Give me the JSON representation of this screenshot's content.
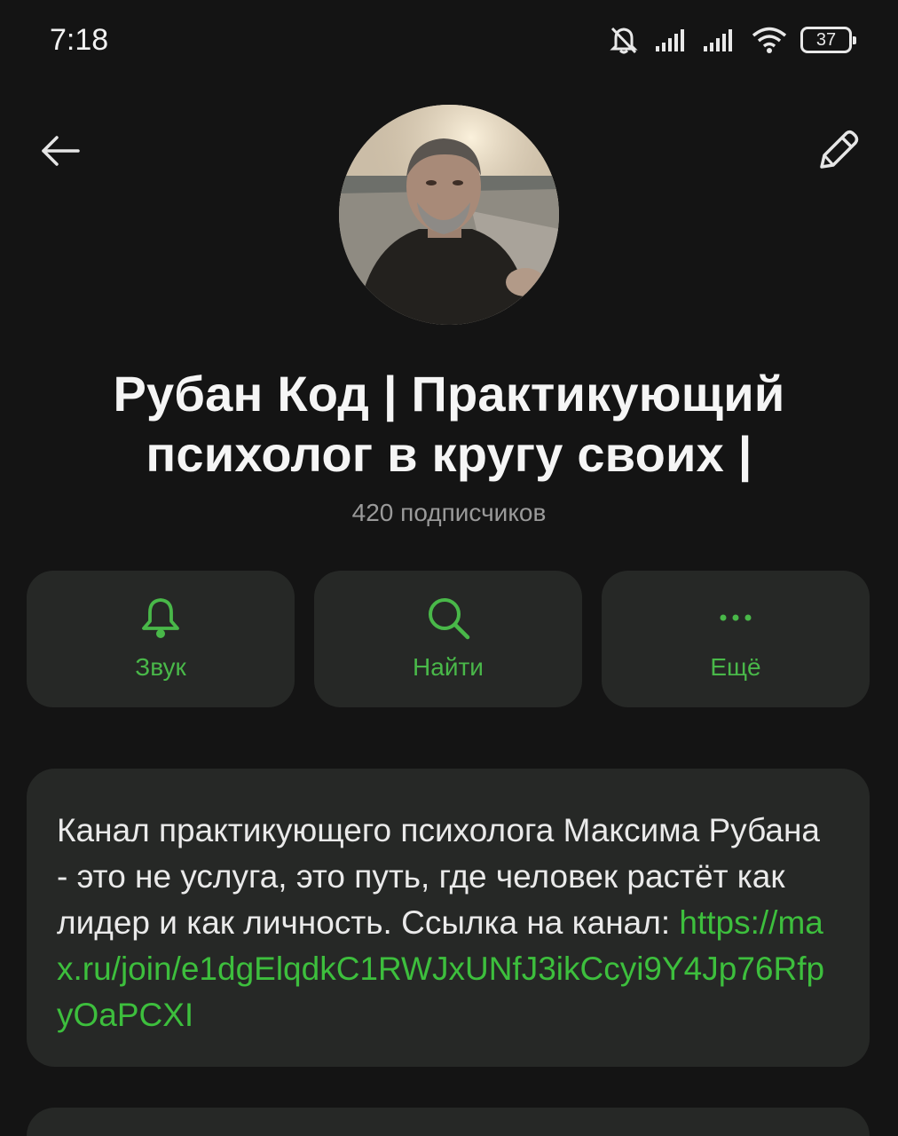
{
  "status_bar": {
    "time": "7:18",
    "battery": "37",
    "icons": [
      "mute-icon",
      "signal-icon",
      "signal-icon",
      "wifi-icon",
      "battery-icon"
    ]
  },
  "header": {
    "back_icon": "arrow-left-icon",
    "edit_icon": "pencil-icon"
  },
  "channel": {
    "title_line1": "Рубан Код | Практикующий",
    "title_line2": "психолог в кругу своих |",
    "subscribers": "420 подписчиков"
  },
  "actions": [
    {
      "label": "Звук",
      "icon": "bell-icon"
    },
    {
      "label": "Найти",
      "icon": "search-icon"
    },
    {
      "label": "Ещё",
      "icon": "more-icon"
    }
  ],
  "description": {
    "text": "Канал практикующего психолога Максима Рубана -  это не услуга, это путь, где человек растёт как лидер и как личность. Ссылка на канал: ",
    "link": "https://max.ru/join/e1dgElqdkC1RWJxUNfJ3ikCcyi9Y4Jp76RfpyOaPCXI"
  },
  "colors": {
    "background": "#141414",
    "card": "#262826",
    "accent": "#49b849",
    "link": "#3dbf3d"
  }
}
